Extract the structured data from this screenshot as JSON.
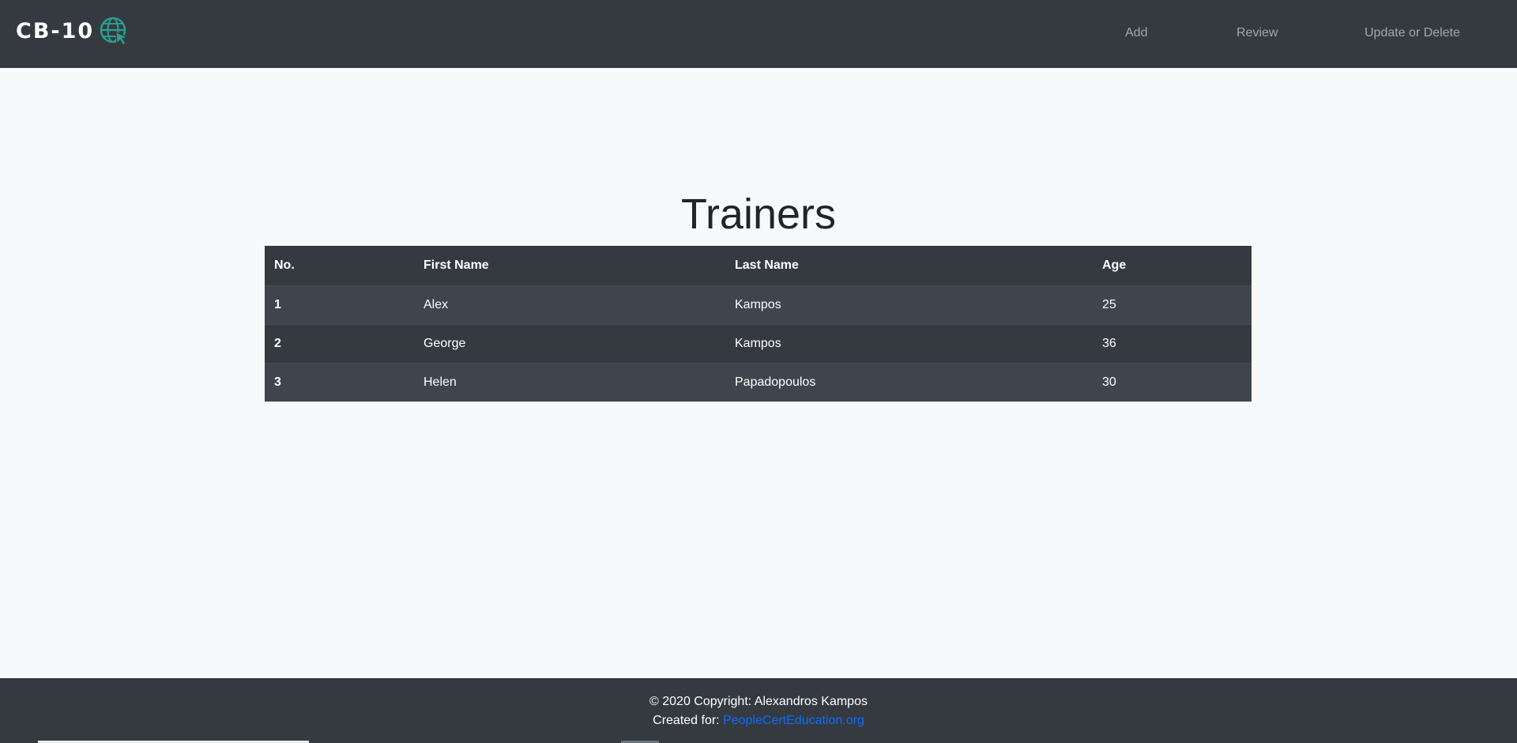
{
  "navbar": {
    "brand_text": "CB-10",
    "logo_icon": "globe-cursor-icon",
    "links": [
      "Add",
      "Review",
      "Update or Delete"
    ]
  },
  "main": {
    "title": "Trainers",
    "table": {
      "headers": [
        "No.",
        "First Name",
        "Last Name",
        "Age"
      ],
      "rows": [
        [
          "1",
          "Alex",
          "Kampos",
          "25"
        ],
        [
          "2",
          "George",
          "Kampos",
          "36"
        ],
        [
          "3",
          "Helen",
          "Papadopoulos",
          "30"
        ]
      ]
    }
  },
  "footer": {
    "copyright": "© 2020 Copyright: Alexandros Kampos",
    "created_for_label": "Created for:",
    "created_for_link": "PeopleCertEducation.org"
  },
  "colors": {
    "navbar_bg": "#343a40",
    "page_bg": "#f8f9fa",
    "logo_accent": "#2a9d8f",
    "link": "#0d6efd"
  }
}
